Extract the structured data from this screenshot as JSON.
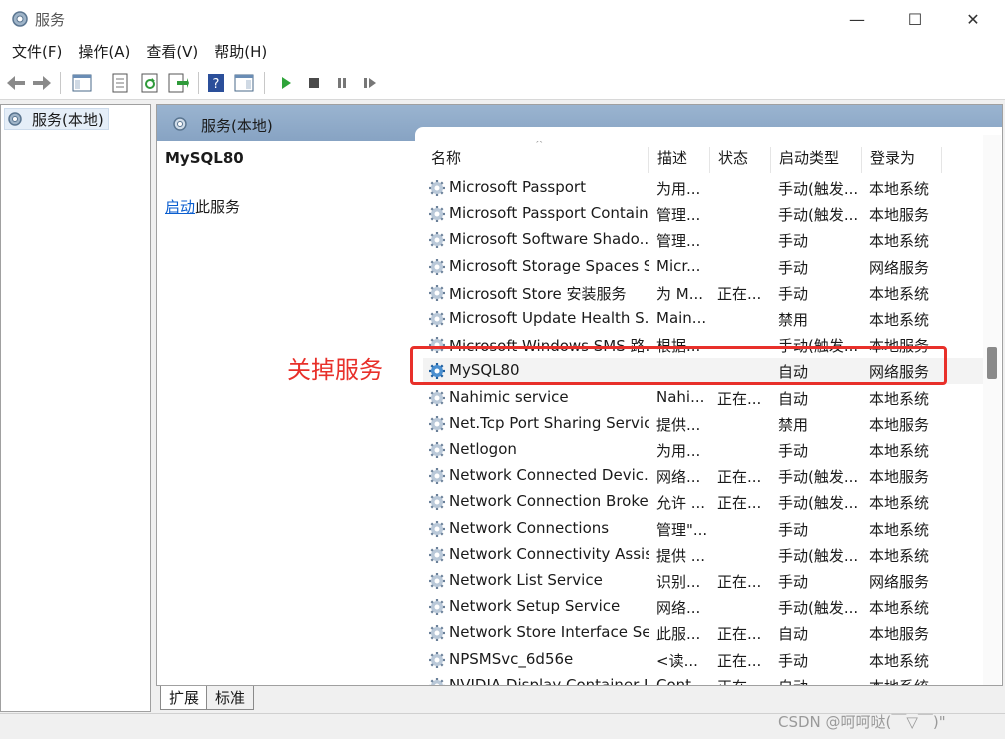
{
  "window": {
    "title": "服务",
    "minimize_glyph": "—",
    "maximize_glyph": "☐",
    "close_glyph": "✕"
  },
  "menu": [
    "文件(F)",
    "操作(A)",
    "查看(V)",
    "帮助(H)"
  ],
  "toolbar": {
    "icons": [
      "back-icon",
      "forward-icon",
      "show-hide-console-tree-icon",
      "properties-icon",
      "refresh-icon",
      "export-list-icon",
      "help-icon",
      "show-hide-action-pane-icon",
      "start-service-icon",
      "stop-service-icon",
      "pause-service-icon",
      "restart-service-icon"
    ]
  },
  "tree": {
    "root_label": "服务(本地)"
  },
  "right_header": {
    "label": "服务(本地)"
  },
  "detail": {
    "service_name": "MySQL80",
    "action_link": "启动",
    "action_suffix": "此服务"
  },
  "columns": [
    "名称",
    "描述",
    "状态",
    "启动类型",
    "登录为"
  ],
  "rows": [
    {
      "name": "Microsoft Passport",
      "desc": "为用...",
      "status": "",
      "startup": "手动(触发...",
      "logon": "本地系统"
    },
    {
      "name": "Microsoft Passport Container",
      "desc": "管理...",
      "status": "",
      "startup": "手动(触发...",
      "logon": "本地服务"
    },
    {
      "name": "Microsoft Software Shado...",
      "desc": "管理...",
      "status": "",
      "startup": "手动",
      "logon": "本地系统"
    },
    {
      "name": "Microsoft Storage Spaces S...",
      "desc": "Micr...",
      "status": "",
      "startup": "手动",
      "logon": "网络服务"
    },
    {
      "name": "Microsoft Store 安装服务",
      "desc": "为 M...",
      "status": "正在...",
      "startup": "手动",
      "logon": "本地系统"
    },
    {
      "name": "Microsoft Update Health S...",
      "desc": "Main...",
      "status": "",
      "startup": "禁用",
      "logon": "本地系统"
    },
    {
      "name": "Microsoft Windows SMS 路...",
      "desc": "根据...",
      "status": "",
      "startup": "手动(触发...",
      "logon": "本地服务"
    },
    {
      "name": "MySQL80",
      "desc": "",
      "status": "",
      "startup": "自动",
      "logon": "网络服务"
    },
    {
      "name": "Nahimic service",
      "desc": "Nahi...",
      "status": "正在...",
      "startup": "自动",
      "logon": "本地系统"
    },
    {
      "name": "Net.Tcp Port Sharing Service",
      "desc": "提供...",
      "status": "",
      "startup": "禁用",
      "logon": "本地服务"
    },
    {
      "name": "Netlogon",
      "desc": "为用...",
      "status": "",
      "startup": "手动",
      "logon": "本地系统"
    },
    {
      "name": "Network Connected Devic...",
      "desc": "网络...",
      "status": "正在...",
      "startup": "手动(触发...",
      "logon": "本地服务"
    },
    {
      "name": "Network Connection Broker",
      "desc": "允许 ...",
      "status": "正在...",
      "startup": "手动(触发...",
      "logon": "本地系统"
    },
    {
      "name": "Network Connections",
      "desc": "管理\"...",
      "status": "",
      "startup": "手动",
      "logon": "本地系统"
    },
    {
      "name": "Network Connectivity Assis...",
      "desc": "提供 ...",
      "status": "",
      "startup": "手动(触发...",
      "logon": "本地系统"
    },
    {
      "name": "Network List Service",
      "desc": "识别...",
      "status": "正在...",
      "startup": "手动",
      "logon": "网络服务"
    },
    {
      "name": "Network Setup Service",
      "desc": "网络...",
      "status": "",
      "startup": "手动(触发...",
      "logon": "本地系统"
    },
    {
      "name": "Network Store Interface Se...",
      "desc": "此服...",
      "status": "正在...",
      "startup": "自动",
      "logon": "本地服务"
    },
    {
      "name": "NPSMSvc_6d56e",
      "desc": "<读...",
      "status": "正在...",
      "startup": "手动",
      "logon": "本地系统"
    },
    {
      "name": "NVIDIA Display Container LS",
      "desc": "Cont...",
      "status": "正在...",
      "startup": "自动",
      "logon": "本地系统"
    }
  ],
  "selected_row_index": 7,
  "tabs": [
    "扩展",
    "标准"
  ],
  "annotation": {
    "text": "关掉服务",
    "color": "#e8302a"
  },
  "watermark": "CSDN @呵呵哒(￣▽￣)\""
}
